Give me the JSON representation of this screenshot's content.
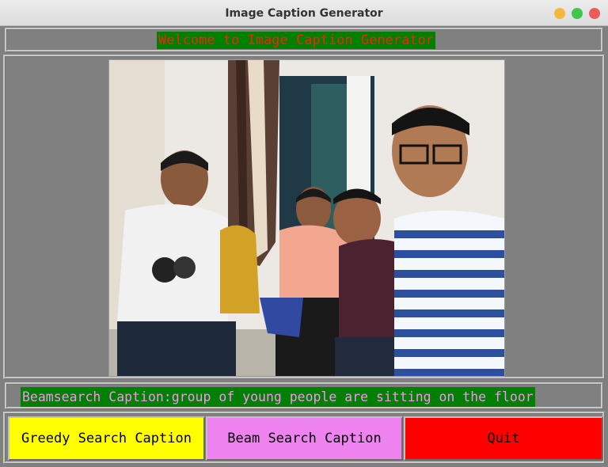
{
  "window": {
    "title": "Image Caption Generator"
  },
  "header": {
    "text": "Welcome to Image Caption Generator"
  },
  "caption": {
    "text": "Beamsearch Caption:group of young people are sitting on the floor"
  },
  "buttons": {
    "greedy": "Greedy Search Caption",
    "beam": "Beam Search Caption",
    "quit": "Quit"
  },
  "colors": {
    "header_bg": "#008000",
    "header_fg": "#ff1a1a",
    "caption_fg": "#ff8cff",
    "greedy_bg": "#ffff00",
    "beam_bg": "#ee82ee",
    "quit_bg": "#ff0000"
  }
}
